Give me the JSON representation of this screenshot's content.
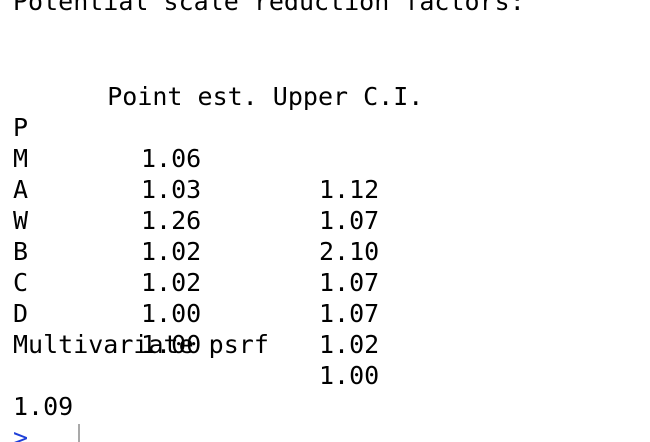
{
  "console": {
    "header_text": "Potential scale reduction factors:",
    "table": {
      "columns": [
        "",
        "Point est.",
        "Upper C.I."
      ],
      "rows": [
        {
          "name": "P",
          "point_est": "1.06",
          "upper_ci": "1.12"
        },
        {
          "name": "M",
          "point_est": "1.03",
          "upper_ci": "1.07"
        },
        {
          "name": "A",
          "point_est": "1.26",
          "upper_ci": "2.10"
        },
        {
          "name": "W",
          "point_est": "1.02",
          "upper_ci": "1.07"
        },
        {
          "name": "B",
          "point_est": "1.02",
          "upper_ci": "1.07"
        },
        {
          "name": "C",
          "point_est": "1.00",
          "upper_ci": "1.02"
        },
        {
          "name": "D",
          "point_est": "1.00",
          "upper_ci": "1.00"
        }
      ]
    },
    "multivariate_label": "Multivariate psrf",
    "multivariate_value": "1.09",
    "prompt_symbol": ">"
  },
  "colors": {
    "text": "#000000",
    "prompt": "#1e3fd8",
    "background": "#ffffff"
  }
}
